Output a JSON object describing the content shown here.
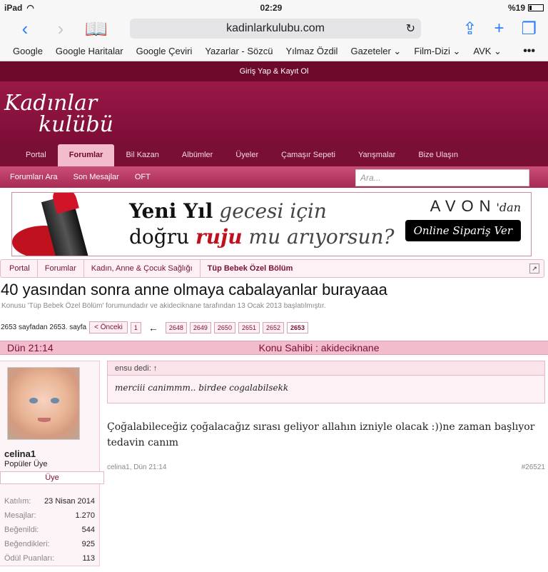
{
  "status": {
    "device": "iPad",
    "time": "02:29",
    "battery": "%19"
  },
  "browser": {
    "url": "kadinlarkulubu.com",
    "bookmarks": [
      "Google",
      "Google Haritalar",
      "Google Çeviri",
      "Yazarlar - Sözcü",
      "Yılmaz Özdil",
      "Gazeteler ⌄",
      "Film-Dizi ⌄",
      "AVK ⌄"
    ],
    "more": "•••"
  },
  "site": {
    "login_text": "Giriş Yap & Kayıt Ol",
    "logo_line1": "Kadınlar",
    "logo_line2": "kulübü",
    "nav_tabs": [
      "Portal",
      "Forumlar",
      "Bil Kazan",
      "Albümler",
      "Üyeler",
      "Çamaşır Sepeti",
      "Yarışmalar",
      "Bize Ulaşın"
    ],
    "subnav": [
      "Forumları Ara",
      "Son Mesajlar",
      "OFT"
    ],
    "search_placeholder": "Ara..."
  },
  "banner": {
    "line1a": "Yeni Yıl",
    "line1b": "gecesi için",
    "line2a": "doğru",
    "line2b": "ruju",
    "line2c": "mu arıyorsun?",
    "brand": "AVON",
    "brand_suffix": "'dan",
    "cta": "Online Sipariş Ver"
  },
  "breadcrumb": [
    "Portal",
    "Forumlar",
    "Kadın, Anne & Çocuk Sağlığı",
    "Tüp Bebek Özel Bölüm"
  ],
  "thread": {
    "title": "40 yasından sonra anne olmaya cabalayanlar burayaaa",
    "subtitle": "Konusu 'Tüp Bebek Özel Bölüm' forumundadır ve akideciknane tarafından 13 Ocak 2013 başlatılmıştır.",
    "pager_text": "2653 sayfadan 2653. sayfa",
    "prev": "< Önceki",
    "first_page": "1",
    "arrow": "←",
    "pages": [
      "2648",
      "2649",
      "2650",
      "2651",
      "2652",
      "2653"
    ]
  },
  "post": {
    "date": "Dün 21:14",
    "owner_label": "Konu Sahibi : akideciknane",
    "username": "celina1",
    "user_title": "Popüler Üye",
    "badge": "Üye",
    "stats": [
      {
        "k": "Katılım:",
        "v": "23 Nisan 2014"
      },
      {
        "k": "Mesajlar:",
        "v": "1.270"
      },
      {
        "k": "Beğenildi:",
        "v": "544"
      },
      {
        "k": "Beğendikleri:",
        "v": "925"
      },
      {
        "k": "Ödül Puanları:",
        "v": "113"
      }
    ],
    "quote_head": "ensu dedi: ↑",
    "quote_body": "merciii canimmm.. birdee cogalabilsekk",
    "message": "Çoğalabileceğiz çoğalacağız sırası geliyor allahın izniyle olacak :))ne zaman başlıyor tedavin canım",
    "footer_left": "celina1, Dün 21:14",
    "footer_right": "#26521"
  }
}
